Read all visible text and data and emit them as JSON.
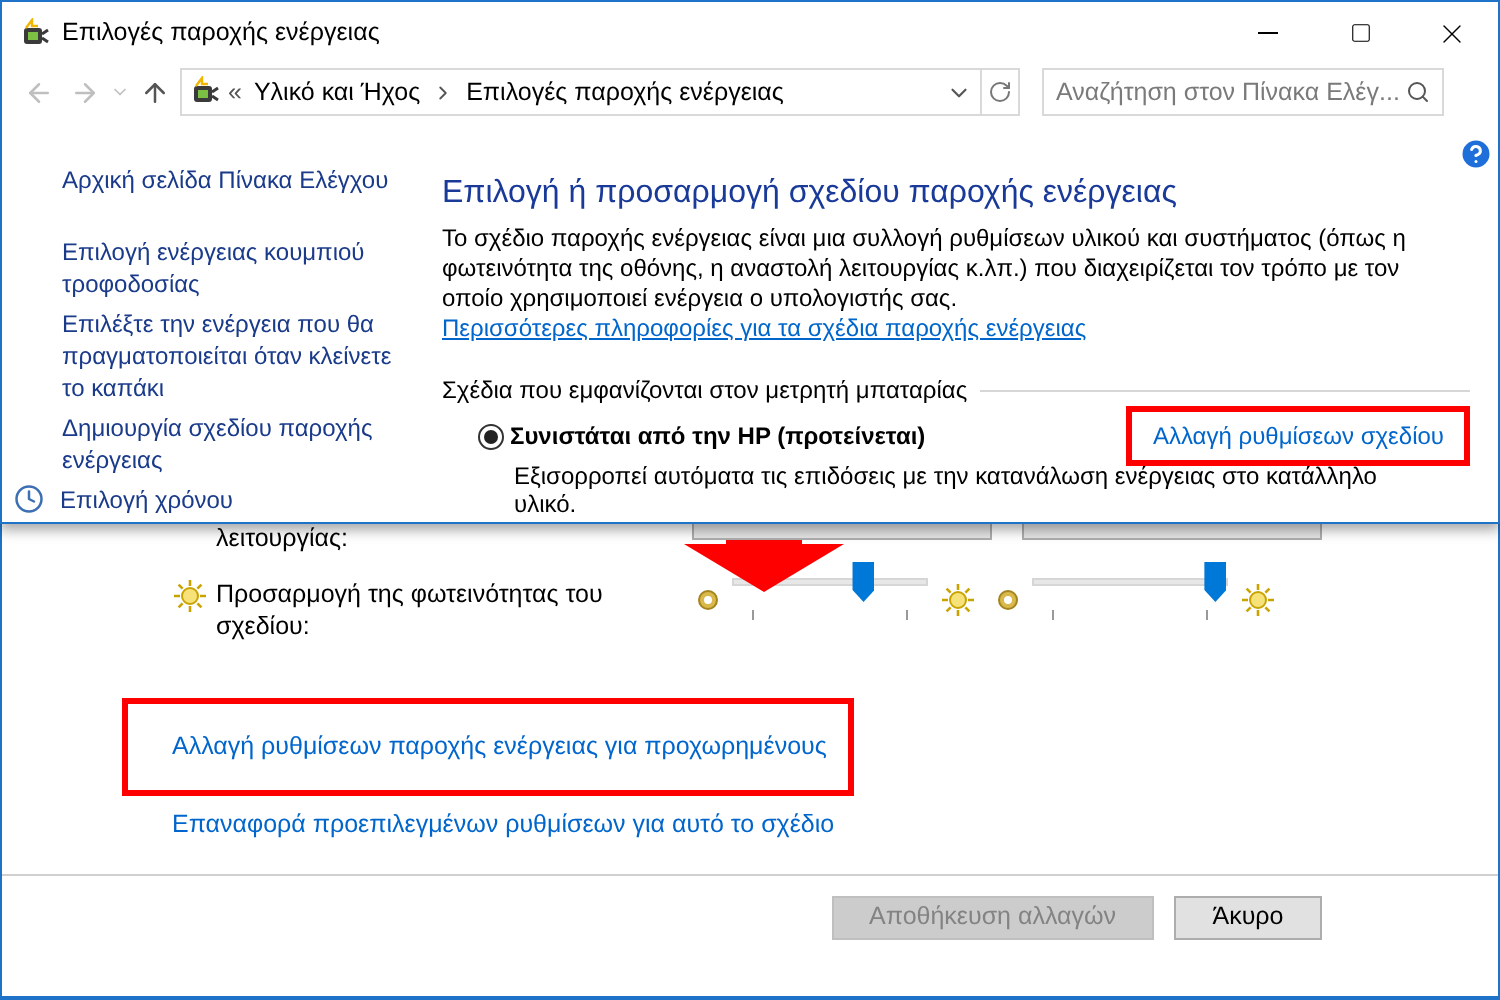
{
  "window": {
    "title": "Επιλογές παροχής ενέργειας"
  },
  "address_bar": {
    "overflow": "«",
    "breadcrumb": [
      "Υλικό και Ήχος",
      "Επιλογές παροχής ενέργειας"
    ]
  },
  "search": {
    "placeholder": "Αναζήτηση στον Πίνακα Ελέγ..."
  },
  "sidebar": {
    "items": [
      {
        "label": "Αρχική σελίδα Πίνακα Ελέγχου",
        "kind": "home"
      },
      {
        "label": "Επιλογή ενέργειας κουμπιού τροφοδοσίας",
        "kind": "link"
      },
      {
        "label": "Επιλέξτε την ενέργεια που θα πραγματοποιείται όταν κλείνετε το καπάκι",
        "kind": "link"
      },
      {
        "label": "Δημιουργία σχεδίου παροχής ενέργειας",
        "kind": "link"
      },
      {
        "label": "Επιλογή χρόνου",
        "kind": "icon-link"
      }
    ]
  },
  "main": {
    "heading": "Επιλογή ή προσαρμογή σχεδίου παροχής ενέργειας",
    "description": "Το σχέδιο παροχής ενέργειας είναι μια συλλογή ρυθμίσεων υλικού και συστήματος (όπως η φωτεινότητα της οθόνης, η αναστολή λειτουργίας κ.λπ.) που διαχειρίζεται τον τρόπο με τον οποίο χρησιμοποιεί ενέργεια ο υπολογιστής σας.",
    "more_link": "Περισσότερες πληροφορίες για τα σχέδια παροχής ενέργειας",
    "plans_label": "Σχέδια που εμφανίζονται στον μετρητή μπαταρίας",
    "plans": [
      {
        "name": "Συνιστάται από την HP (προτείνεται)",
        "selected": true,
        "description": "Εξισορροπεί αυτόματα τις επιδόσεις με την κατανάλωση ενέργειας στο κατάλληλο υλικό.",
        "change_link": "Αλλαγή ρυθμίσεων σχεδίου",
        "highlighted": true
      }
    ]
  },
  "plan_settings": {
    "partial_label": "λειτουργίας:",
    "brightness": {
      "label": "Προσαρμογή της φωτεινότητας του σχεδίου:",
      "sliders": [
        {
          "level": 0.68
        },
        {
          "level": 0.95
        }
      ]
    },
    "links": [
      {
        "text": "Αλλαγή ρυθμίσεων παροχής ενέργειας για προχωρημένους",
        "highlighted": true
      },
      {
        "text": "Επαναφορά προεπιλεγμένων ρυθμίσεων για αυτό το σχέδιο",
        "highlighted": false
      }
    ],
    "buttons": [
      {
        "label": "Αποθήκευση αλλαγών",
        "disabled": true
      },
      {
        "label": "Άκυρο",
        "disabled": false
      }
    ]
  }
}
